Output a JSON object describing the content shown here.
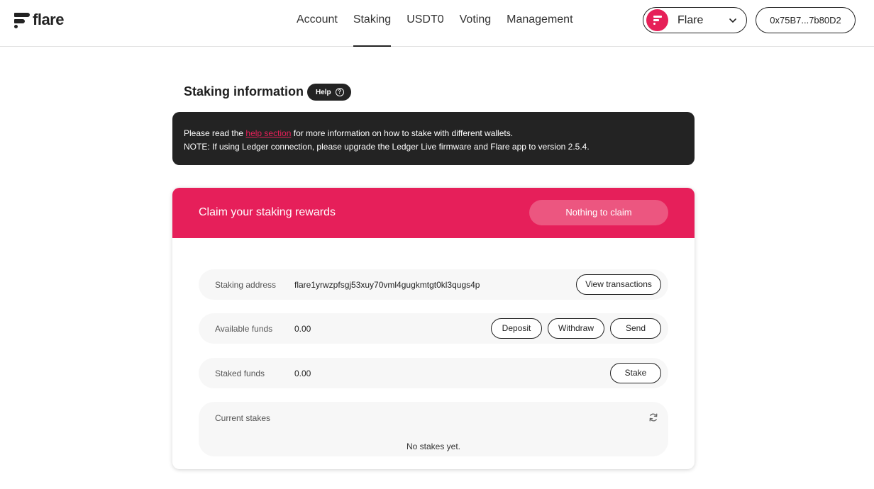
{
  "header": {
    "logo_text": "flare",
    "nav": [
      "Account",
      "Staking",
      "USDT0",
      "Voting",
      "Management"
    ],
    "active_nav": "Staking",
    "network": "Flare",
    "wallet": "0x75B7...7b80D2"
  },
  "page": {
    "title": "Staking information",
    "help_label": "Help",
    "banner": {
      "line1_prefix": "Please read the ",
      "line1_link": "help section",
      "line1_suffix": " for more information on how to stake with different wallets.",
      "line2": "NOTE: If using Ledger connection, please upgrade the Ledger Live firmware and Flare app to version 2.5.4."
    }
  },
  "card": {
    "title": "Claim your staking rewards",
    "claim_label": "Nothing to claim",
    "staking_address": {
      "label": "Staking address",
      "value": "flare1yrwzpfsgj53xuy70vml4gugkmtgt0kl3qugs4p",
      "button": "View transactions"
    },
    "available": {
      "label": "Available funds",
      "value": "0.00",
      "deposit": "Deposit",
      "withdraw": "Withdraw",
      "send": "Send"
    },
    "staked": {
      "label": "Staked funds",
      "value": "0.00",
      "stake": "Stake"
    },
    "current_stakes": {
      "label": "Current stakes",
      "empty": "No stakes yet."
    }
  },
  "colors": {
    "accent": "#e61f5a",
    "dark": "#232323"
  }
}
